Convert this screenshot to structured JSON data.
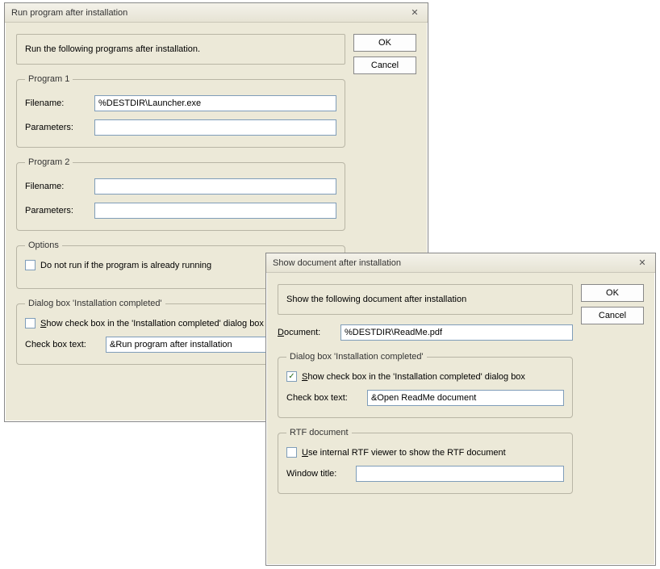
{
  "dialog1": {
    "title": "Run program after installation",
    "info": "Run the following programs after installation.",
    "ok": "OK",
    "cancel": "Cancel",
    "program1": {
      "legend": "Program 1",
      "filename_label": "Filename:",
      "filename_value": "%DESTDIR\\Launcher.exe",
      "parameters_label": "Parameters:",
      "parameters_value": ""
    },
    "program2": {
      "legend": "Program 2",
      "filename_label": "Filename:",
      "filename_value": "",
      "parameters_label": "Parameters:",
      "parameters_value": ""
    },
    "options": {
      "legend": "Options",
      "do_not_run_label": "Do not run if the program is already running"
    },
    "dialogbox": {
      "legend": "Dialog box 'Installation completed'",
      "show_checkbox_prefix": "S",
      "show_checkbox_rest": "how check box in the 'Installation completed' dialog box",
      "checkbox_text_label": "Check box text:",
      "checkbox_text_value": "&Run program after installation"
    }
  },
  "dialog2": {
    "title": "Show document after installation",
    "info": "Show the following document after installation",
    "ok": "OK",
    "cancel": "Cancel",
    "document_prefix": "D",
    "document_rest": "ocument:",
    "document_value": "%DESTDIR\\ReadMe.pdf",
    "dialogbox": {
      "legend": "Dialog box 'Installation completed'",
      "show_checkbox_prefix": "S",
      "show_checkbox_rest": "how check box in the 'Installation completed' dialog box",
      "checkbox_text_label": "Check box text:",
      "checkbox_text_value": "&Open ReadMe document"
    },
    "rtf": {
      "legend": "RTF document",
      "use_viewer_prefix": "U",
      "use_viewer_rest": "se internal RTF viewer to show the RTF document",
      "window_title_label": "Window title:",
      "window_title_value": ""
    }
  }
}
